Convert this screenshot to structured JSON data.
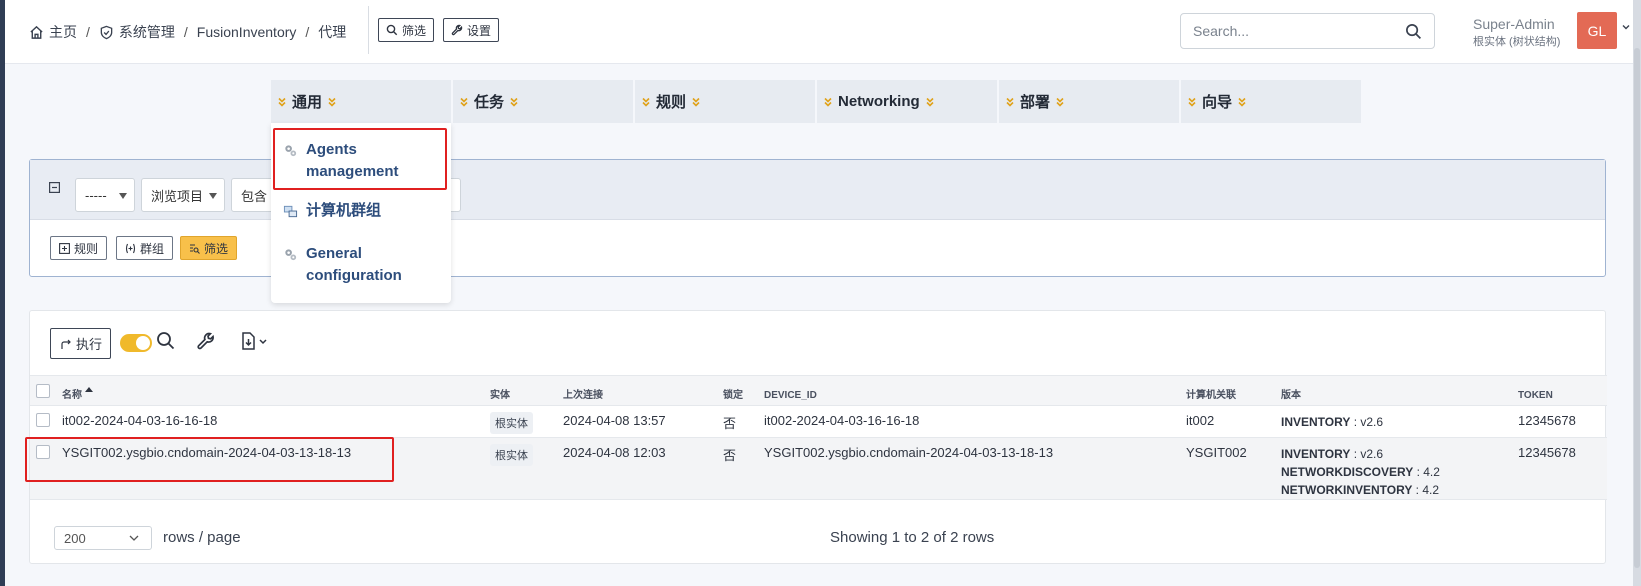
{
  "header": {
    "breadcrumb": {
      "home": "主页",
      "admin": "系统管理",
      "plugin": "FusionInventory",
      "current": "代理",
      "separator": "/"
    },
    "filter_button": "筛选",
    "settings_button": "设置",
    "search_placeholder": "Search...",
    "user_name": "Super-Admin",
    "user_entity": "根实体 (树状结构)",
    "avatar_initials": "GL"
  },
  "tabs": [
    {
      "label": "通用"
    },
    {
      "label": "任务"
    },
    {
      "label": "规则"
    },
    {
      "label": "Networking"
    },
    {
      "label": "部署"
    },
    {
      "label": "向导"
    }
  ],
  "dropdown": {
    "items": [
      {
        "label": "Agents management",
        "icon": "gears-icon"
      },
      {
        "label": "计算机群组",
        "icon": "computer-group-icon"
      },
      {
        "label": "General configuration",
        "icon": "gears-icon"
      }
    ]
  },
  "criteria": {
    "field_select": "-----",
    "browse_select": "浏览项目",
    "operator_select": "包含",
    "rule_button": "规则",
    "group_button": "群组",
    "filter_button": "筛选"
  },
  "results": {
    "execute_button": "执行",
    "columns": [
      "名称",
      "实体",
      "上次连接",
      "锁定",
      "DEVICE_ID",
      "计算机关联",
      "版本",
      "TOKEN"
    ],
    "rows": [
      {
        "name": "it002-2024-04-03-16-16-18",
        "entity": "根实体",
        "last_contact": "2024-04-08 13:57",
        "locked": "否",
        "device_id": "it002-2024-04-03-16-16-18",
        "computer": "it002",
        "versions": [
          {
            "key": "INVENTORY",
            "value": "v2.6"
          }
        ],
        "token": "12345678"
      },
      {
        "name": "YSGIT002.ysgbio.cndomain-2024-04-03-13-18-13",
        "entity": "根实体",
        "last_contact": "2024-04-08 12:03",
        "locked": "否",
        "device_id": "YSGIT002.ysgbio.cndomain-2024-04-03-13-18-13",
        "computer": "YSGIT002",
        "versions": [
          {
            "key": "INVENTORY",
            "value": "v2.6"
          },
          {
            "key": "NETWORKDISCOVERY",
            "value": "4.2"
          },
          {
            "key": "NETWORKINVENTORY",
            "value": "4.2"
          }
        ],
        "token": "12345678"
      }
    ],
    "page_size": "200",
    "rows_per_page_label": "rows / page",
    "showing_text": "Showing 1 to 2 of 2 rows"
  },
  "colors": {
    "accent_yellow": "#f8c04a",
    "link_blue": "#2d4d7c",
    "annotation_red": "#e02020",
    "avatar_bg": "#e36a55"
  }
}
